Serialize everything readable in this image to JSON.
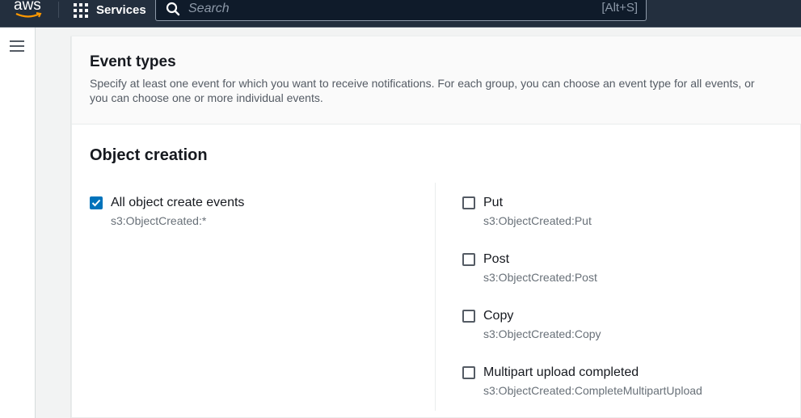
{
  "topbar": {
    "logo_text": "aws",
    "services_label": "Services",
    "search_placeholder": "Search",
    "search_shortcut": "[Alt+S]"
  },
  "panel": {
    "title": "Event types",
    "description": "Specify at least one event for which you want to receive notifications. For each group, you can choose an event type for all events, or you can choose one or more individual events.",
    "section_title": "Object creation",
    "all_option": {
      "label": "All object create events",
      "description": "s3:ObjectCreated:*",
      "checked": true
    },
    "options": [
      {
        "label": "Put",
        "description": "s3:ObjectCreated:Put",
        "checked": false
      },
      {
        "label": "Post",
        "description": "s3:ObjectCreated:Post",
        "checked": false
      },
      {
        "label": "Copy",
        "description": "s3:ObjectCreated:Copy",
        "checked": false
      },
      {
        "label": "Multipart upload completed",
        "description": "s3:ObjectCreated:CompleteMultipartUpload",
        "checked": false
      }
    ]
  },
  "colors": {
    "topbar_bg": "#232f3e",
    "checkbox_checked": "#0073bb"
  }
}
